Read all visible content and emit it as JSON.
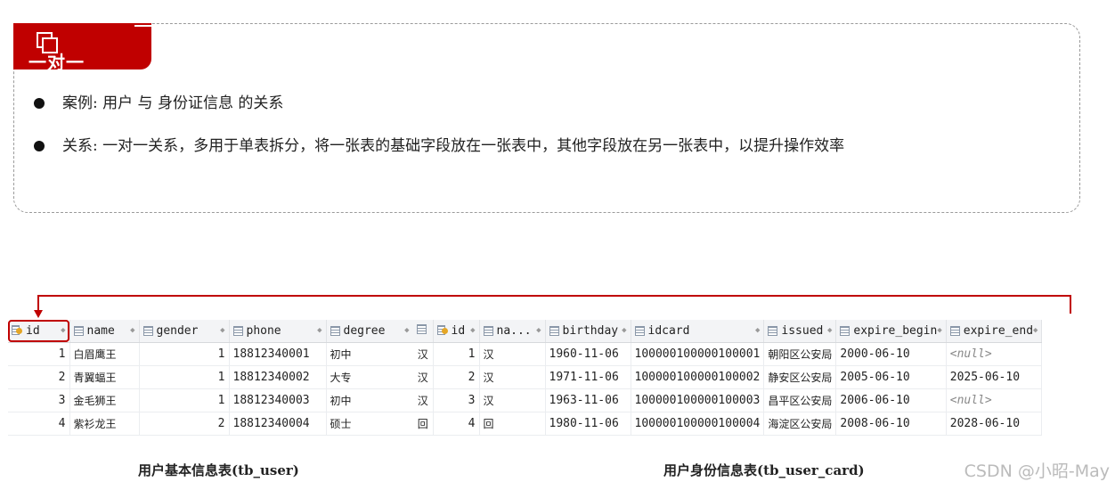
{
  "slide": {
    "title": "一对一",
    "bullets": [
      "案例: 用户  与  身份证信息  的关系",
      "关系: 一对一关系，多用于单表拆分，将一张表的基础字段放在一张表中，其他字段放在另一张表中，以提升操作效率"
    ]
  },
  "user_table": {
    "caption": "用户基本信息表(tb_user)",
    "columns": [
      "id",
      "name",
      "gender",
      "phone",
      "degree"
    ],
    "rows": [
      [
        "1",
        "白眉鹰王",
        "1",
        "18812340001",
        "初中"
      ],
      [
        "2",
        "青翼蝠王",
        "1",
        "18812340002",
        "大专"
      ],
      [
        "3",
        "金毛狮王",
        "1",
        "18812340003",
        "初中"
      ],
      [
        "4",
        "紫衫龙王",
        "2",
        "18812340004",
        "硕士"
      ]
    ]
  },
  "card_table": {
    "caption": "用户身份信息表(tb_user_card)",
    "left_strip": [
      "汉",
      "汉",
      "汉",
      "回"
    ],
    "columns": [
      "id",
      "na...",
      "birthday",
      "idcard",
      "issued",
      "expire_begin",
      "expire_end"
    ],
    "rows": [
      [
        "1",
        "汉",
        "1960-11-06",
        "100000100000100001",
        "朝阳区公安局",
        "2000-06-10",
        "<null>"
      ],
      [
        "2",
        "汉",
        "1971-11-06",
        "100000100000100002",
        "静安区公安局",
        "2005-06-10",
        "2025-06-10"
      ],
      [
        "3",
        "汉",
        "1963-11-06",
        "100000100000100003",
        "昌平区公安局",
        "2006-06-10",
        "<null>"
      ],
      [
        "4",
        "回",
        "1980-11-06",
        "100000100000100004",
        "海淀区公安局",
        "2008-06-10",
        "2028-06-10"
      ]
    ]
  },
  "watermark": "CSDN @小昭-May",
  "colors": {
    "accent": "#c00000",
    "header_bg": "#f3f4f6",
    "null_text": "#888888"
  }
}
